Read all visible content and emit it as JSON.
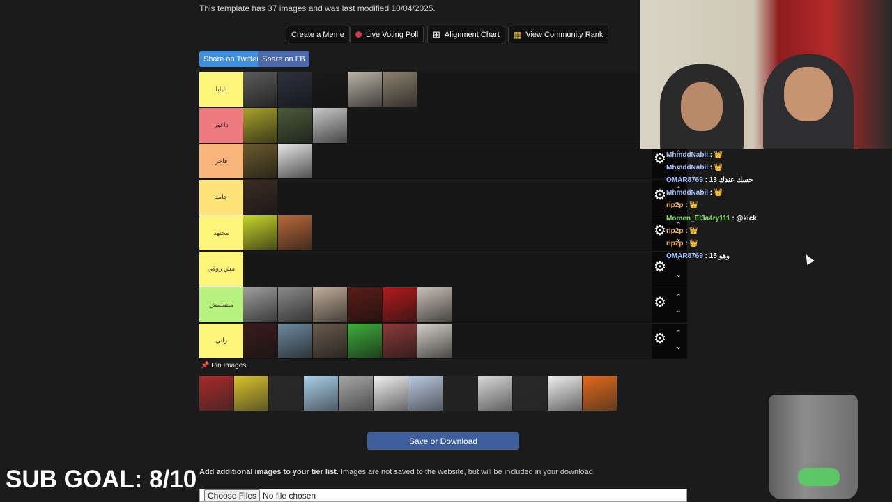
{
  "info_text": "This template has 37 images and was last modified 10/04/2025.",
  "toolbar": {
    "create_meme": "Create a Meme",
    "live_voting": "Live Voting Poll",
    "alignment_chart": "Alignment Chart",
    "community_rank": "View Community Rank"
  },
  "share": {
    "twitter": "Share on Twitter",
    "fb": "Share on FB"
  },
  "tiers": [
    {
      "label": "البابا",
      "color": "#fdf47a",
      "images": [
        "#5b5b5b",
        "#2d3140",
        "#1a1a1a",
        "#b9b4a7",
        "#8c8270"
      ]
    },
    {
      "label": "داعور",
      "color": "#ee7b80",
      "images": [
        "#a7a22a",
        "#4b5a3c",
        "#c9c9c9"
      ]
    },
    {
      "label": "فاجر",
      "color": "#f8b57b",
      "images": [
        "#6a5a2c",
        "#e6e6e6"
      ]
    },
    {
      "label": "جامد",
      "color": "#fde379",
      "images": [
        "#3c2c24"
      ]
    },
    {
      "label": "مجتهد",
      "color": "#fdf47a",
      "images": [
        "#c7d62a",
        "#b7693a"
      ]
    },
    {
      "label": "مش زوقي",
      "color": "#fdf47a",
      "images": []
    },
    {
      "label": "مبتسمش",
      "color": "#b8f27e",
      "images": [
        "#9e9e9e",
        "#8a8a8a",
        "#c2ae9a",
        "#5a1c16",
        "#b31c1c",
        "#c8c0b6"
      ]
    },
    {
      "label": "زاني",
      "color": "#fdf47a",
      "images": [
        "#3a1c1c",
        "#6e8aa0",
        "#6a5a4c",
        "#3fae3c",
        "#8c3a3a",
        "#d3d0c8"
      ]
    }
  ],
  "pin_label": "Pin Images",
  "pin_images": [
    "#a82a2a",
    "#d8c32a",
    "#2a2a2a",
    "#a9d0ea",
    "#a7a7a7",
    "#f1f1f1",
    "#b9c8e0",
    "#222222",
    "#d9d9d9",
    "#2a2a2a",
    "#efefef",
    "#e36a1a"
  ],
  "save_button": "Save or Download",
  "add_text_bold": "Add additional images to your tier list.",
  "add_text": " Images are not saved to the website, but will be included in your download.",
  "file_input": {
    "button": "Choose Files",
    "status": "No file chosen"
  },
  "sub_goal": "SUB GOAL: 8/10",
  "chat": [
    {
      "user": "MhmddNabil",
      "text": ": 👑",
      "color": "#a9c2ff"
    },
    {
      "user": "MhmddNabil",
      "text": ": 👑",
      "color": "#a9c2ff"
    },
    {
      "user": "OMAR8769",
      "text": ": 13 حسك عندك",
      "color": "#a9c2ff"
    },
    {
      "user": "MhmddNabil",
      "text": ": 👑",
      "color": "#a9c2ff"
    },
    {
      "user": "rip2p",
      "text": ": 👑",
      "color": "#f4b04a"
    },
    {
      "user": "Momen_El3a4ry111",
      "text": ": @kick",
      "color": "#7ee85a"
    },
    {
      "user": "rip2p",
      "text": ": 👑",
      "color": "#f4b04a"
    },
    {
      "user": "rip2p",
      "text": ": 👑",
      "color": "#f4b04a"
    },
    {
      "user": "OMAR8769",
      "text": ": 15 وهو",
      "color": "#a9c2ff"
    }
  ]
}
